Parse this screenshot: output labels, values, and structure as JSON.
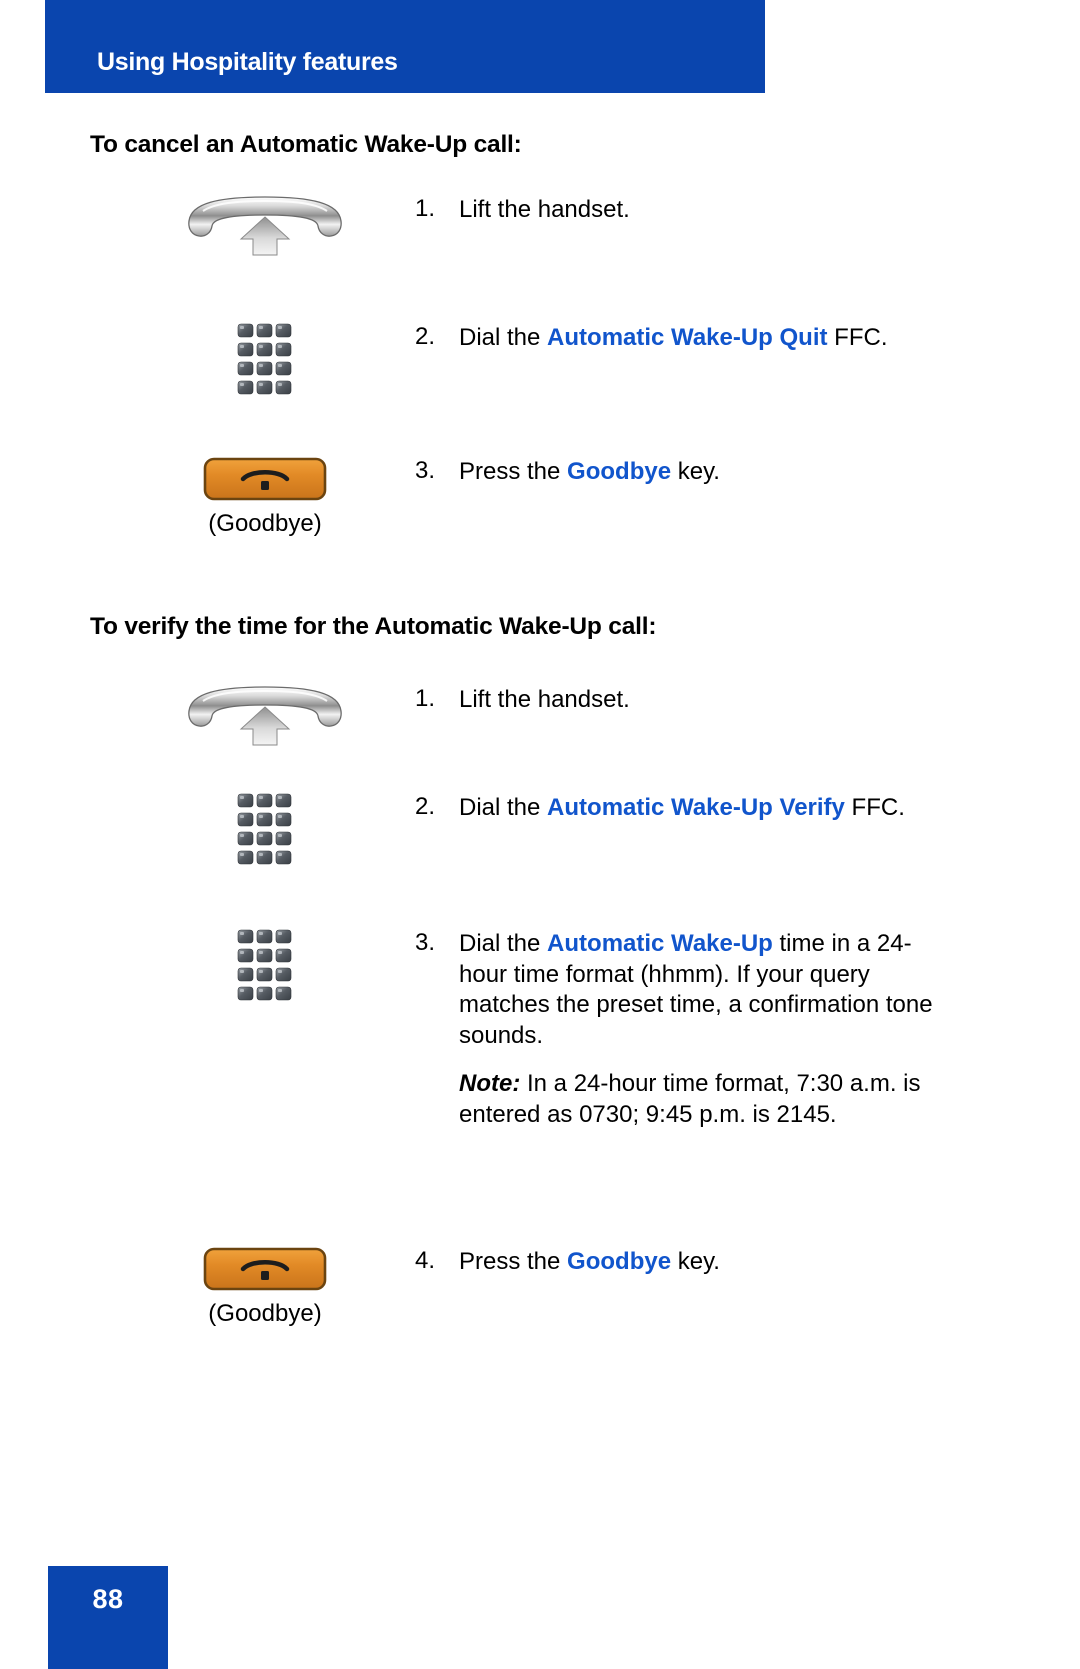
{
  "header": {
    "title": "Using Hospitality features",
    "banner_color": "#0A45AE"
  },
  "colors": {
    "banner_blue": "#0A45AE",
    "keyword_blue": "#1155CC",
    "goodbye_orange": "#E08A28",
    "keypad_gray": "#5A6068"
  },
  "sections": [
    {
      "heading": "To cancel an Automatic Wake-Up call:",
      "steps": [
        {
          "number": "1.",
          "icon": "handset-lift-icon",
          "caption": "",
          "text_pre": "Lift the handset.",
          "text_keyword": "",
          "text_post": ""
        },
        {
          "number": "2.",
          "icon": "keypad-icon",
          "caption": "",
          "text_pre": "Dial the ",
          "text_keyword": "Automatic Wake-Up Quit",
          "text_post": " FFC."
        },
        {
          "number": "3.",
          "icon": "goodbye-key-icon",
          "caption": "(Goodbye)",
          "text_pre": "Press the ",
          "text_keyword": "Goodbye",
          "text_post": " key."
        }
      ]
    },
    {
      "heading": "To verify the time for the Automatic Wake-Up call:",
      "steps": [
        {
          "number": "1.",
          "icon": "handset-lift-icon",
          "caption": "",
          "text_pre": "Lift the handset.",
          "text_keyword": "",
          "text_post": ""
        },
        {
          "number": "2.",
          "icon": "keypad-icon",
          "caption": "",
          "text_pre": "Dial the ",
          "text_keyword": "Automatic Wake-Up Verify",
          "text_post": " FFC."
        },
        {
          "number": "3.",
          "icon": "keypad-icon",
          "caption": "",
          "text_pre": "Dial the ",
          "text_keyword": "Automatic Wake-Up",
          "text_post": " time in a 24-hour time format (hhmm). If your query matches the preset time, a confirmation tone sounds.",
          "note_label": "Note:",
          "note_text": " In a 24-hour time format, 7:30 a.m. is entered as 0730; 9:45 p.m. is 2145."
        },
        {
          "number": "4.",
          "icon": "goodbye-key-icon",
          "caption": "(Goodbye)",
          "text_pre": "Press the ",
          "text_keyword": "Goodbye",
          "text_post": " key."
        }
      ]
    }
  ],
  "footer": {
    "page_number": "88"
  }
}
